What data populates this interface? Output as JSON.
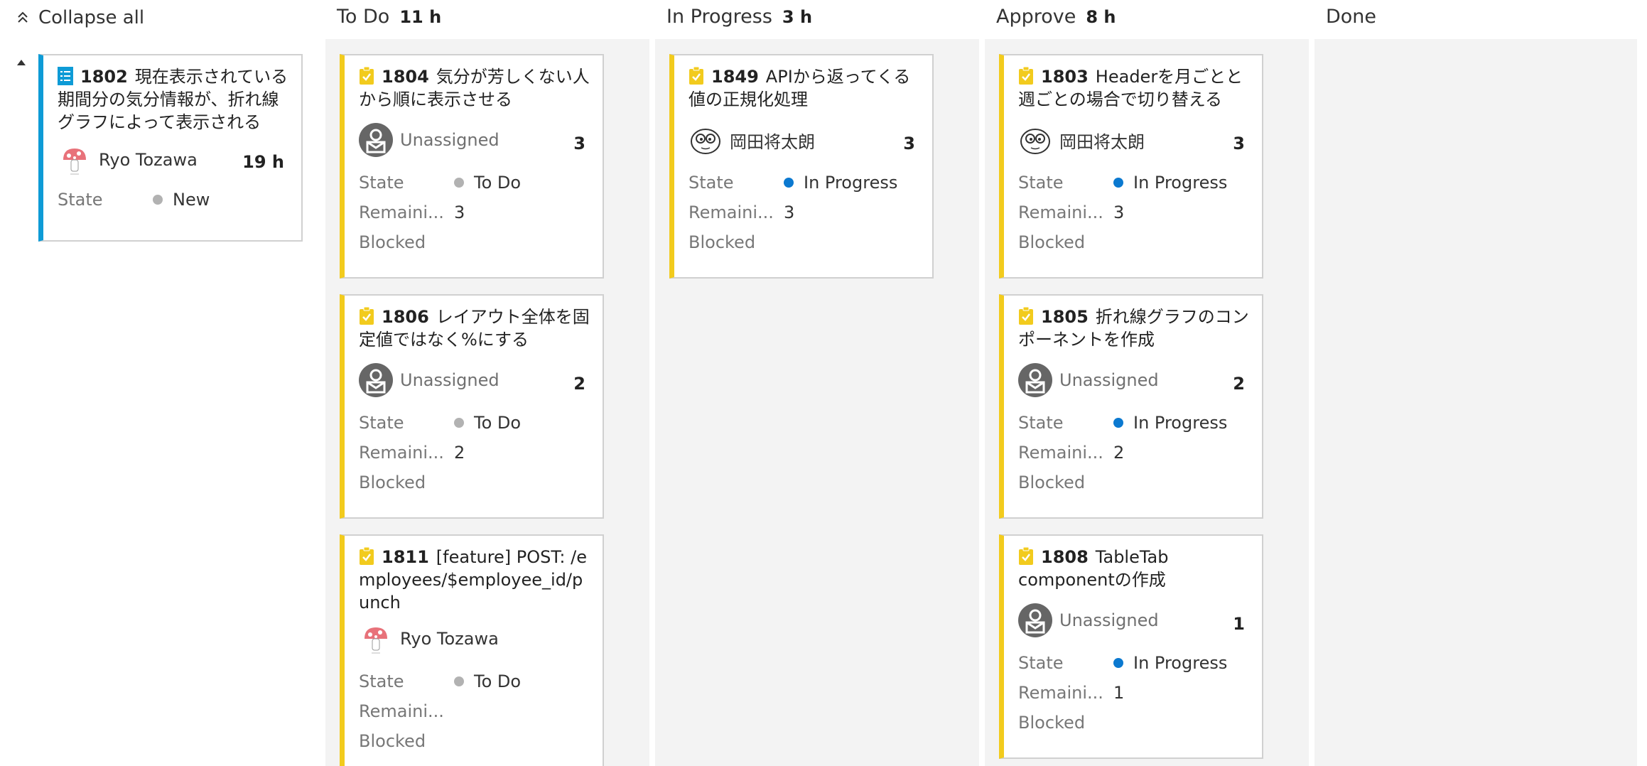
{
  "toolbar": {
    "collapse_label": "Collapse all"
  },
  "colors": {
    "todo_dot": "#b2b2b2",
    "progress_dot": "#0b79d0",
    "new_dot": "#b2b2b2",
    "task_accent": "#f2cb1d",
    "story_accent": "#0e9bd6"
  },
  "labels": {
    "state": "State",
    "remaining": "Remaini...",
    "blocked": "Blocked"
  },
  "columns": [
    {
      "name": "To Do",
      "count": "11 h"
    },
    {
      "name": "In Progress",
      "count": "3 h"
    },
    {
      "name": "Approve",
      "count": "8 h"
    },
    {
      "name": "Done",
      "count": ""
    }
  ],
  "parent": {
    "id": "1802",
    "title": "現在表示されている期間分の気分情報が、折れ線グラフによって表示される",
    "assignee": "Ryo Tozawa",
    "effort": "19 h",
    "state": "New"
  },
  "cards": {
    "c1804": {
      "id": "1804",
      "title": "気分が芳しくない人から順に表示させる",
      "assignee": "Unassigned",
      "effort": "3",
      "state": "To Do",
      "remaining": "3"
    },
    "c1806": {
      "id": "1806",
      "title": "レイアウト全体を固定値ではなく%にする",
      "assignee": "Unassigned",
      "effort": "2",
      "state": "To Do",
      "remaining": "2"
    },
    "c1811": {
      "id": "1811",
      "title": "[feature] POST: /employees/$employee_id/punch",
      "assignee": "Ryo Tozawa",
      "effort": "",
      "state": "To Do",
      "remaining": ""
    },
    "c1849": {
      "id": "1849",
      "title": "APIから返ってくる値の正規化処理",
      "assignee": "岡田将太朗",
      "effort": "3",
      "state": "In Progress",
      "remaining": "3"
    },
    "c1803": {
      "id": "1803",
      "title": "Headerを月ごとと週ごとの場合で切り替える",
      "assignee": "岡田将太朗",
      "effort": "3",
      "state": "In Progress",
      "remaining": "3"
    },
    "c1805": {
      "id": "1805",
      "title": "折れ線グラフのコンポーネントを作成",
      "assignee": "Unassigned",
      "effort": "2",
      "state": "In Progress",
      "remaining": "2"
    },
    "c1808": {
      "id": "1808",
      "title": "TableTab componentの作成",
      "assignee": "Unassigned",
      "effort": "1",
      "state": "In Progress",
      "remaining": "1"
    }
  }
}
